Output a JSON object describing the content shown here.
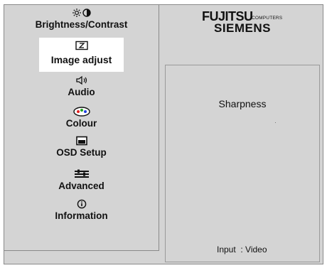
{
  "menu": {
    "items": [
      {
        "label": "Brightness/Contrast",
        "icon": "brightness-contrast-icon"
      },
      {
        "label": "Image adjust",
        "icon": "image-adjust-icon",
        "selected": true
      },
      {
        "label": "Audio",
        "icon": "speaker-icon"
      },
      {
        "label": "Colour",
        "icon": "colour-palette-icon"
      },
      {
        "label": "OSD Setup",
        "icon": "osd-setup-icon"
      },
      {
        "label": "Advanced",
        "icon": "advanced-sliders-icon"
      },
      {
        "label": "Information",
        "icon": "information-icon"
      }
    ]
  },
  "logo": {
    "fujitsu": "FUJITSU",
    "computers": "COMPUTERS",
    "siemens": "SIEMENS"
  },
  "panel": {
    "title": "Sharpness",
    "input_line": "Input  : Video"
  },
  "colors": {
    "background": "#d4d4d4",
    "selected_background": "#ffffff",
    "border": "#8a8a8a"
  }
}
